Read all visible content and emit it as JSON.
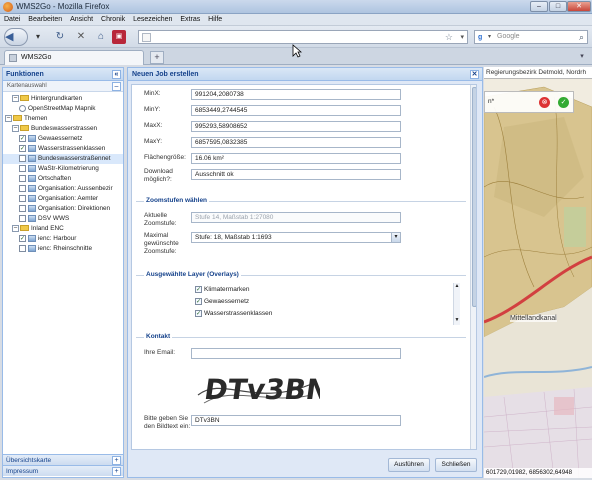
{
  "window": {
    "title": "WMS2Go - Mozilla Firefox",
    "controls": [
      "–",
      "□",
      "✕"
    ]
  },
  "menu": [
    "Datei",
    "Bearbeiten",
    "Ansicht",
    "Chronik",
    "Lesezeichen",
    "Extras",
    "Hilfe"
  ],
  "navbar": {
    "url": "",
    "search_placeholder": "Google"
  },
  "tabs": [
    {
      "label": "WMS2Go"
    }
  ],
  "left_panel": {
    "title": "Funktionen",
    "subtitle": "Kartenauswahl",
    "tree": [
      {
        "label": "Hintergrundkarten",
        "type": "folder",
        "level": 1
      },
      {
        "label": "OpenStreetMap Mapnik",
        "type": "layer",
        "level": 2
      },
      {
        "label": "Themen",
        "type": "folder",
        "level": 0
      },
      {
        "label": "Bundeswasserstrassen",
        "type": "folder",
        "level": 1
      },
      {
        "label": "Gewaessernetz",
        "type": "check",
        "checked": true,
        "level": 2
      },
      {
        "label": "Wasserstrassenklassen",
        "type": "check",
        "checked": true,
        "level": 2
      },
      {
        "label": "Bundeswasserstraßennet",
        "type": "check",
        "checked": false,
        "level": 2,
        "selected": true
      },
      {
        "label": "WaStr-Kilometrierung",
        "type": "check",
        "checked": false,
        "level": 2
      },
      {
        "label": "Ortschaften",
        "type": "check",
        "checked": false,
        "level": 2
      },
      {
        "label": "Organisation: Aussenbezir",
        "type": "check",
        "checked": false,
        "level": 2
      },
      {
        "label": "Organisation: Aemter",
        "type": "check",
        "checked": false,
        "level": 2
      },
      {
        "label": "Organisation: Direktionen",
        "type": "check",
        "checked": false,
        "level": 2
      },
      {
        "label": "DSV WWS",
        "type": "check",
        "checked": false,
        "level": 2
      },
      {
        "label": "Inland ENC",
        "type": "folder",
        "level": 1
      },
      {
        "label": "ienc: Harbour",
        "type": "check",
        "checked": true,
        "level": 2
      },
      {
        "label": "ienc: Rheinschnitte",
        "type": "check",
        "checked": false,
        "level": 2
      }
    ],
    "bottom_panels": [
      "Übersichtskarte",
      "Impressum"
    ]
  },
  "dialog": {
    "title": "Neuen Job erstellen",
    "fields": {
      "minx": {
        "label": "MinX:",
        "value": "991204,2080738"
      },
      "miny": {
        "label": "MinY:",
        "value": "6853449,2744545"
      },
      "maxx": {
        "label": "MaxX:",
        "value": "995293,58908652"
      },
      "maxy": {
        "label": "MaxY:",
        "value": "6857595,0832385"
      },
      "area": {
        "label": "Flächengröße:",
        "value": "16.06 km²"
      },
      "download": {
        "label": "Download möglich?:",
        "value": "Ausschnitt ok"
      }
    },
    "zoom_section": {
      "title": "Zoomstufen wählen",
      "current_label": "Aktuelle Zoomstufe:",
      "current_value": "Stufe 14, Maßstab 1:27080",
      "max_label": "Maximal gewünschte Zoomstufe:",
      "max_value": "Stufe: 18, Maßstab 1:1693"
    },
    "overlay_section": {
      "title": "Ausgewählte Layer (Overlays)",
      "items": [
        {
          "label": "Klimatermarken",
          "checked": true
        },
        {
          "label": "Gewaessernetz",
          "checked": true
        },
        {
          "label": "Wasserstrassenklassen",
          "checked": true
        }
      ]
    },
    "contact_section": {
      "title": "Kontakt",
      "email_label": "Ihre Email:",
      "email_value": "",
      "captcha_text": "DTv3BN",
      "captcha_label": "Bitte geben Sie den Bildtext ein:",
      "captcha_value": "DTv3BN"
    },
    "buttons": {
      "submit": "Ausführen",
      "close": "Schließen"
    }
  },
  "map": {
    "search_text": "Regierungsbezirk Detmold, Nordrh",
    "search_prefix": "n*",
    "place_label": "Mittellandkanal",
    "status": "601729,01982, 6856302,64948",
    "colors": {
      "land": "#d8c48f",
      "forest": "#c1cf9c",
      "canal": "#8fb4d8",
      "road": "#d24040"
    }
  }
}
